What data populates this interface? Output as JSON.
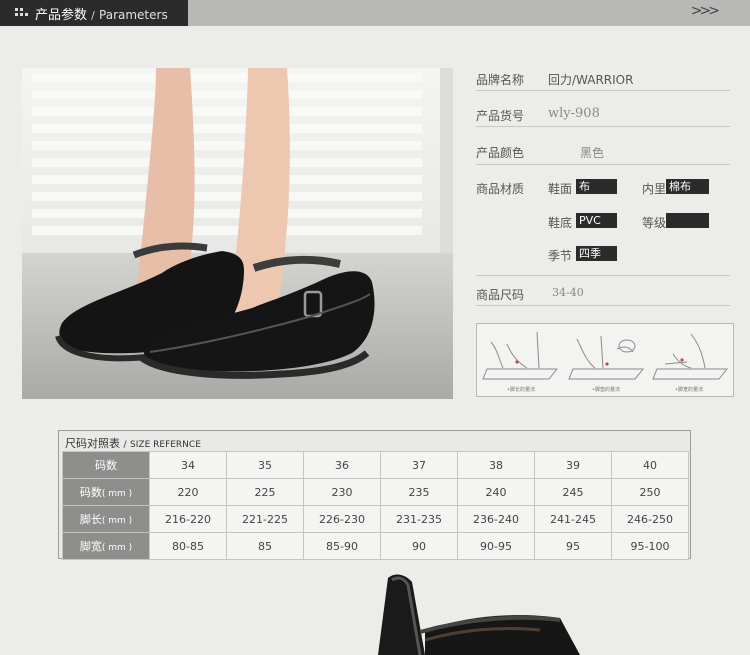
{
  "header": {
    "title_cn": "产品参数",
    "separator": "/",
    "title_en": "Parameters",
    "arrow": ">>>"
  },
  "params": {
    "brand_label": "品牌名称",
    "brand_value": "回力/WARRIOR",
    "sku_label": "产品货号",
    "sku_value": "wly-908",
    "color_label": "产品颜色",
    "color_value": "黑色",
    "material_label": "商品材质",
    "upper_label": "鞋面",
    "upper_value": "布",
    "lining_label": "内里",
    "lining_value": "棉布",
    "sole_label": "鞋底",
    "sole_value": "PVC",
    "grade_label": "等级",
    "grade_value": "",
    "season_label": "季节",
    "season_value": "四季",
    "size_label": "商品尺码",
    "size_value": "34-40"
  },
  "measure_captions": [
    "•脚长的量法",
    "•脚垫的量法",
    "•脚宽的量法"
  ],
  "size_table": {
    "title_cn": "尺码对照表",
    "title_sep": "/",
    "title_en": "SIZE REFERNCE",
    "rows": [
      {
        "label": "码数",
        "unit": "",
        "values": [
          "34",
          "35",
          "36",
          "37",
          "38",
          "39",
          "40"
        ]
      },
      {
        "label": "码数",
        "unit": "( mm )",
        "values": [
          "220",
          "225",
          "230",
          "235",
          "240",
          "245",
          "250"
        ]
      },
      {
        "label": "脚长",
        "unit": "( mm )",
        "values": [
          "216-220",
          "221-225",
          "226-230",
          "231-235",
          "236-240",
          "241-245",
          "246-250"
        ]
      },
      {
        "label": "脚宽",
        "unit": "( mm )",
        "values": [
          "80-85",
          "85",
          "85-90",
          "90",
          "90-95",
          "95",
          "95-100"
        ]
      }
    ]
  },
  "colors": {
    "header_dark": "#2b2b2b",
    "header_grey": "#b8b8b6",
    "row_header": "#8e8e8c",
    "pill": "#2b2b2b",
    "background": "#ecece9"
  }
}
